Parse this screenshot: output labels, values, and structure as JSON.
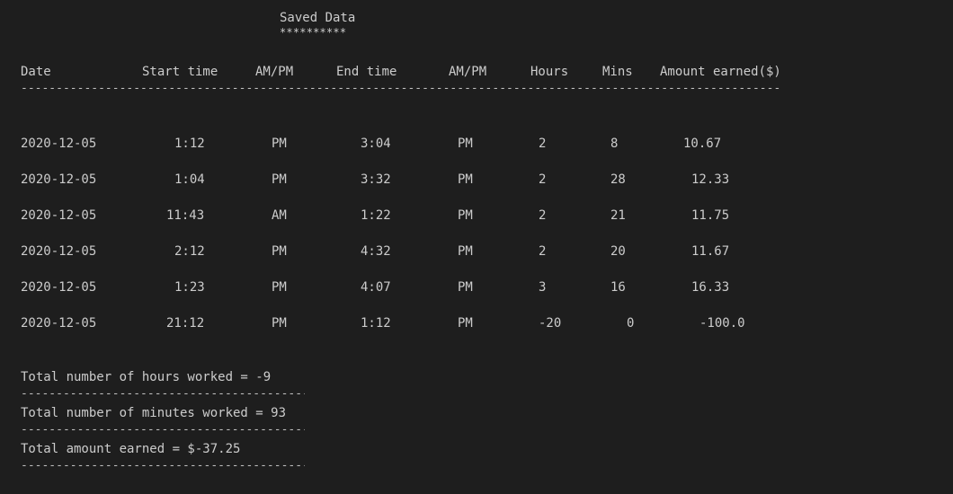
{
  "title": "Saved Data",
  "title_underline": "**********",
  "columns": [
    "Date",
    "Start time",
    "AM/PM",
    "End time",
    "AM/PM",
    "Hours",
    "Mins",
    "Amount earned($)"
  ],
  "rows": [
    [
      "2020-12-05",
      "1:12",
      "PM",
      "3:04",
      "PM",
      "2",
      "8",
      "10.67"
    ],
    [
      "2020-12-05",
      "1:04",
      "PM",
      "3:32",
      "PM",
      "2",
      "28",
      "12.33"
    ],
    [
      "2020-12-05",
      "11:43",
      "AM",
      "1:22",
      "PM",
      "2",
      "21",
      "11.75"
    ],
    [
      "2020-12-05",
      "2:12",
      "PM",
      "4:32",
      "PM",
      "2",
      "20",
      "11.67"
    ],
    [
      "2020-12-05",
      "1:23",
      "PM",
      "4:07",
      "PM",
      "3",
      "16",
      "16.33"
    ],
    [
      "2020-12-05",
      "21:12",
      "PM",
      "1:12",
      "PM",
      "-20",
      "0",
      "-100.0"
    ]
  ],
  "totals": {
    "hours": "Total number of hours worked = -9",
    "minutes": "Total number of minutes worked = 93",
    "amount": "Total amount earned = $-37.25"
  },
  "colors": {
    "background": "#1e1e1e",
    "text": "#cccccc"
  }
}
